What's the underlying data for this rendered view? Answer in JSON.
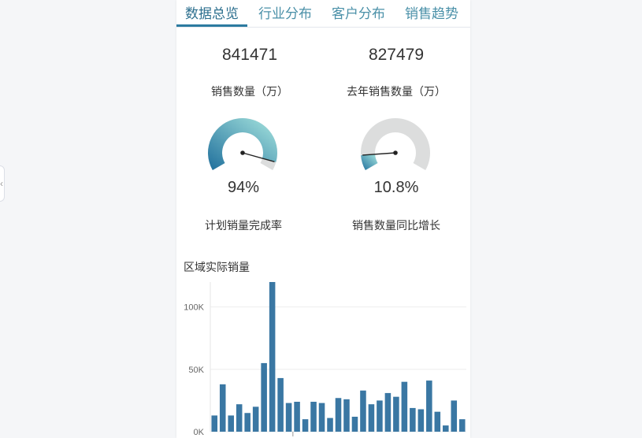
{
  "tabs": [
    {
      "label": "数据总览",
      "active": true
    },
    {
      "label": "行业分布",
      "active": false
    },
    {
      "label": "客户分布",
      "active": false
    },
    {
      "label": "销售趋势",
      "active": false
    }
  ],
  "metrics": [
    {
      "value": "841471",
      "label": "销售数量（万）"
    },
    {
      "value": "827479",
      "label": "去年销售数量（万）"
    }
  ],
  "gauges": [
    {
      "value_text": "94%",
      "fraction": 0.94,
      "label": "计划销量完成率"
    },
    {
      "value_text": "10.8%",
      "fraction": 0.108,
      "label": "销售数量同比增长"
    }
  ],
  "colors": {
    "accent": "#2c7ba0",
    "bar": "#3a77a3",
    "gauge_track": "#dcdddd",
    "gauge_start": "#1f6f9c",
    "gauge_end": "#a8e6df"
  },
  "side_toggle_icon": "chevron-left-icon",
  "chart_data": {
    "type": "bar",
    "title": "区域实际销量",
    "yticks": [
      "0K",
      "50K",
      "100K"
    ],
    "ylim": [
      0,
      120000
    ],
    "grid": true,
    "values": [
      13000,
      38000,
      13000,
      22000,
      15000,
      20000,
      55000,
      120000,
      43000,
      23000,
      24000,
      10000,
      24000,
      23000,
      11000,
      27000,
      26000,
      12000,
      33000,
      22000,
      25000,
      31000,
      28000,
      40000,
      19000,
      18000,
      41000,
      16000,
      5000,
      25000,
      10000
    ]
  }
}
